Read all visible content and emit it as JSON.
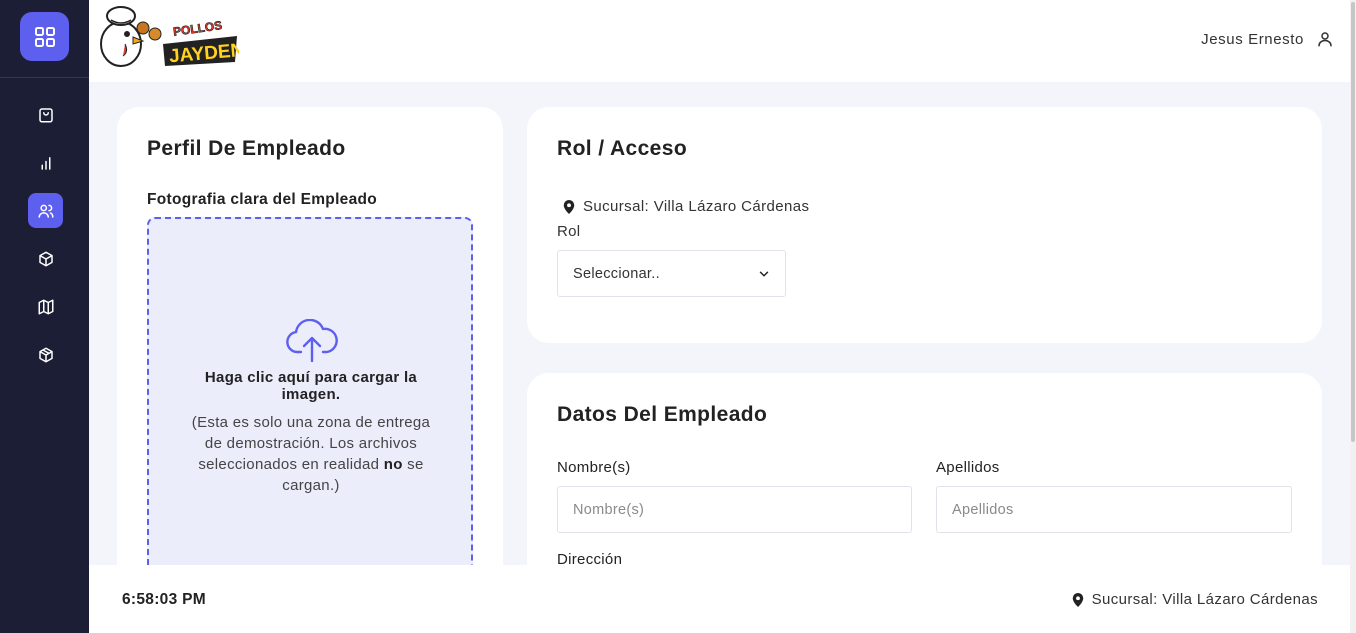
{
  "header": {
    "brand_text_top": "POLLOS",
    "brand_text_main": "JAYDEN",
    "user_name": "Jesus Ernesto"
  },
  "sidebar": {
    "items": [
      {
        "icon": "shopping-bag-icon",
        "active": false
      },
      {
        "icon": "bar-chart-icon",
        "active": false
      },
      {
        "icon": "users-icon",
        "active": true
      },
      {
        "icon": "box-icon",
        "active": false
      },
      {
        "icon": "map-icon",
        "active": false
      },
      {
        "icon": "package-icon",
        "active": false
      }
    ]
  },
  "profile": {
    "title": "Perfil De Empleado",
    "photo_label": "Fotografia clara del Empleado",
    "upload_main": "Haga clic aquí para cargar la imagen.",
    "upload_sub_1": "(Esta es solo una zona de entrega de demostración. Los archivos seleccionados en realidad ",
    "upload_sub_bold": "no",
    "upload_sub_2": " se cargan.)"
  },
  "role": {
    "title": "Rol / Acceso",
    "branch": "Sucursal: Villa Lázaro Cárdenas",
    "rol_label": "Rol",
    "rol_selected": "Seleccionar.."
  },
  "employee": {
    "title": "Datos Del Empleado",
    "name_label": "Nombre(s)",
    "name_placeholder": "Nombre(s)",
    "surname_label": "Apellidos",
    "surname_placeholder": "Apellidos",
    "address_label": "Dirección"
  },
  "footer": {
    "time": "6:58:03 PM",
    "branch": "Sucursal: Villa Lázaro Cárdenas"
  },
  "colors": {
    "sidebar_bg": "#1c1e35",
    "accent": "#5d5fef",
    "page_bg": "#f4f5fb",
    "dropzone_bg": "#ecedfb"
  }
}
